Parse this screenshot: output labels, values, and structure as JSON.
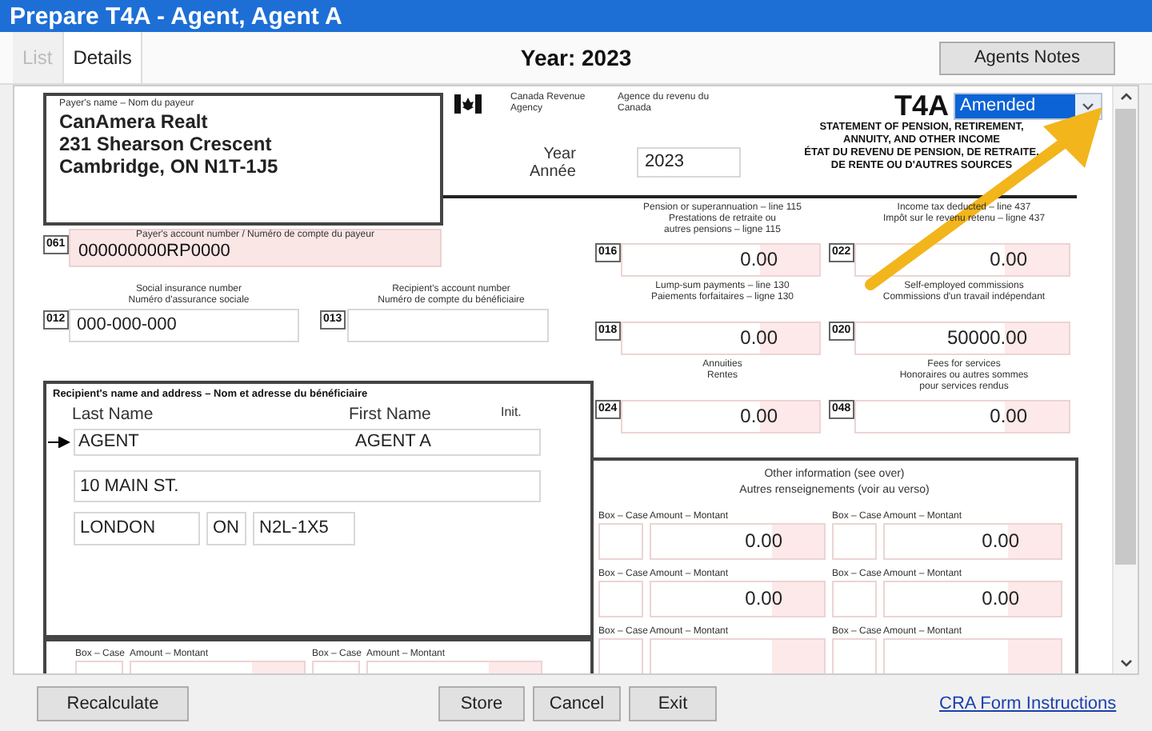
{
  "window": {
    "title": "Prepare T4A - Agent, Agent A"
  },
  "tabs": [
    {
      "label": "List",
      "selected": false,
      "disabled": true
    },
    {
      "label": "Details",
      "selected": true,
      "disabled": false
    }
  ],
  "year_heading": "Year: 2023",
  "agents_notes_button": "Agents Notes",
  "form": {
    "payer": {
      "label": "Payer's name – Nom du payeur",
      "lines": [
        "CanAmera Realt",
        "231 Shearson Crescent",
        "Cambridge, ON  N1T-1J5"
      ]
    },
    "agency_en": "Canada Revenue Agency",
    "agency_fr": "Agence du revenu du Canada",
    "form_code": "T4A",
    "status_dropdown": {
      "value": "Amended"
    },
    "title_lines": [
      "STATEMENT OF PENSION, RETIREMENT,",
      "ANNUITY, AND OTHER INCOME",
      "ÉTAT DU REVENU DE PENSION, DE RETRAITE,",
      "DE RENTE OU D'AUTRES SOURCES"
    ],
    "year_label_en": "Year",
    "year_label_fr": "Année",
    "year_value": "2023",
    "payer_account": {
      "code": "061",
      "label": "Payer's account number / Numéro de compte du payeur",
      "value": "000000000RP0000"
    },
    "sin": {
      "code": "012",
      "label_lines": [
        "Social insurance number",
        "Numéro d'assurance sociale"
      ],
      "value": "000-000-000"
    },
    "recipient_account": {
      "code": "013",
      "label_lines": [
        "Recipient's account number",
        "Numéro de compte du bénéficiaire"
      ]
    },
    "recipient": {
      "heading": "Recipient's name and address – Nom et adresse du bénéficiaire",
      "last_name_label": "Last Name",
      "first_name_label": "First Name",
      "initial_label": "Init.",
      "last_name": "AGENT",
      "first_name": "AGENT A",
      "address": "10 MAIN ST.",
      "city": "LONDON",
      "province": "ON",
      "postal_code": "N2L-1X5"
    },
    "amount_boxes": [
      {
        "code": "016",
        "label_lines": [
          "Pension or superannuation – line 115",
          "Prestations de retraite ou",
          "autres pensions – ligne 115"
        ],
        "value": "0.00"
      },
      {
        "code": "022",
        "label_lines": [
          "Income tax deducted – line 437",
          "Impôt sur le revenu retenu – ligne 437"
        ],
        "value": "0.00"
      },
      {
        "code": "018",
        "label_lines": [
          "Lump-sum payments – line 130",
          "Paiements forfaitaires – ligne 130"
        ],
        "value": "0.00"
      },
      {
        "code": "020",
        "label_lines": [
          "Self-employed commissions",
          "Commissions d'un travail indépendant"
        ],
        "value": "50000.00"
      },
      {
        "code": "024",
        "label_lines": [
          "Annuities",
          "Rentes"
        ],
        "value": "0.00"
      },
      {
        "code": "048",
        "label_lines": [
          "Fees for services",
          "Honoraires ou autres sommes",
          "pour services rendus"
        ],
        "value": "0.00"
      }
    ],
    "other_information": {
      "heading_lines": [
        "Other information (see over)",
        "Autres renseignements (voir au verso)"
      ],
      "rows": [
        [
          {
            "box_label": "Box – Case",
            "amount_label": "Amount – Montant",
            "value": "0.00"
          },
          {
            "box_label": "Box – Case",
            "amount_label": "Amount – Montant",
            "value": "0.00"
          }
        ],
        [
          {
            "box_label": "Box – Case",
            "amount_label": "Amount – Montant",
            "value": "0.00"
          },
          {
            "box_label": "Box – Case",
            "amount_label": "Amount – Montant",
            "value": "0.00"
          }
        ],
        [
          {
            "box_label": "Box – Case",
            "amount_label": "Amount – Montant"
          },
          {
            "box_label": "Box – Case",
            "amount_label": "Amount – Montant"
          }
        ]
      ]
    },
    "lower_left_row": [
      {
        "box_label": "Box – Case",
        "amount_label": "Amount – Montant"
      },
      {
        "box_label": "Box – Case",
        "amount_label": "Amount – Montant"
      }
    ]
  },
  "buttons": [
    "Recalculate",
    "Store",
    "Cancel",
    "Exit"
  ],
  "link": "CRA Form Instructions",
  "annotation": {
    "kind": "arrow"
  }
}
